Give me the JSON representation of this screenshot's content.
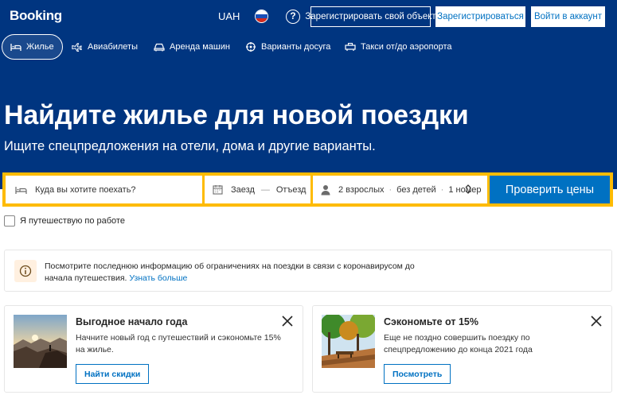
{
  "header": {
    "logo": "Booking",
    "currency": "UAH",
    "help_label": "?",
    "register_property_label": "Зарегистрировать свой объект",
    "register_label": "Зарегистрироваться",
    "signin_label": "Войти в аккаунт"
  },
  "nav": {
    "items": [
      {
        "label": "Жилье",
        "icon": "bed-icon",
        "active": true
      },
      {
        "label": "Авиабилеты",
        "icon": "plane-icon",
        "active": false
      },
      {
        "label": "Аренда машин",
        "icon": "car-icon",
        "active": false
      },
      {
        "label": "Варианты досуга",
        "icon": "attractions-icon",
        "active": false
      },
      {
        "label": "Такси от/до аэропорта",
        "icon": "taxi-icon",
        "active": false
      }
    ]
  },
  "hero": {
    "title": "Найдите жилье для новой поездки",
    "subtitle": "Ищите спецпредложения на отели, дома и другие варианты."
  },
  "search": {
    "destination_placeholder": "Куда вы хотите поехать?",
    "checkin": "Заезд",
    "dash": "—",
    "checkout": "Отъезд",
    "adults": "2 взрослых",
    "sep": "·",
    "children": "без детей",
    "rooms": "1 номер",
    "submit_label": "Проверить цены"
  },
  "work_trip_label": "Я путешествую по работе",
  "notice": {
    "text": "Посмотрите последнюю информацию об ограничениях на поездки в связи с коронавирусом до начала путешествия.",
    "link": "Узнать больше"
  },
  "cards": [
    {
      "title": "Выгодное начало года",
      "body": "Начните новый год с путешествий и сэкономьте 15% на жилье.",
      "button": "Найти скидки"
    },
    {
      "title": "Сэкономьте от 15%",
      "body": "Еще не поздно совершить поездку по спецпредложению до конца 2021 года",
      "button": "Посмотреть"
    }
  ],
  "colors": {
    "brand_blue": "#003580",
    "action_blue": "#0071c2",
    "search_yellow": "#febb02"
  }
}
